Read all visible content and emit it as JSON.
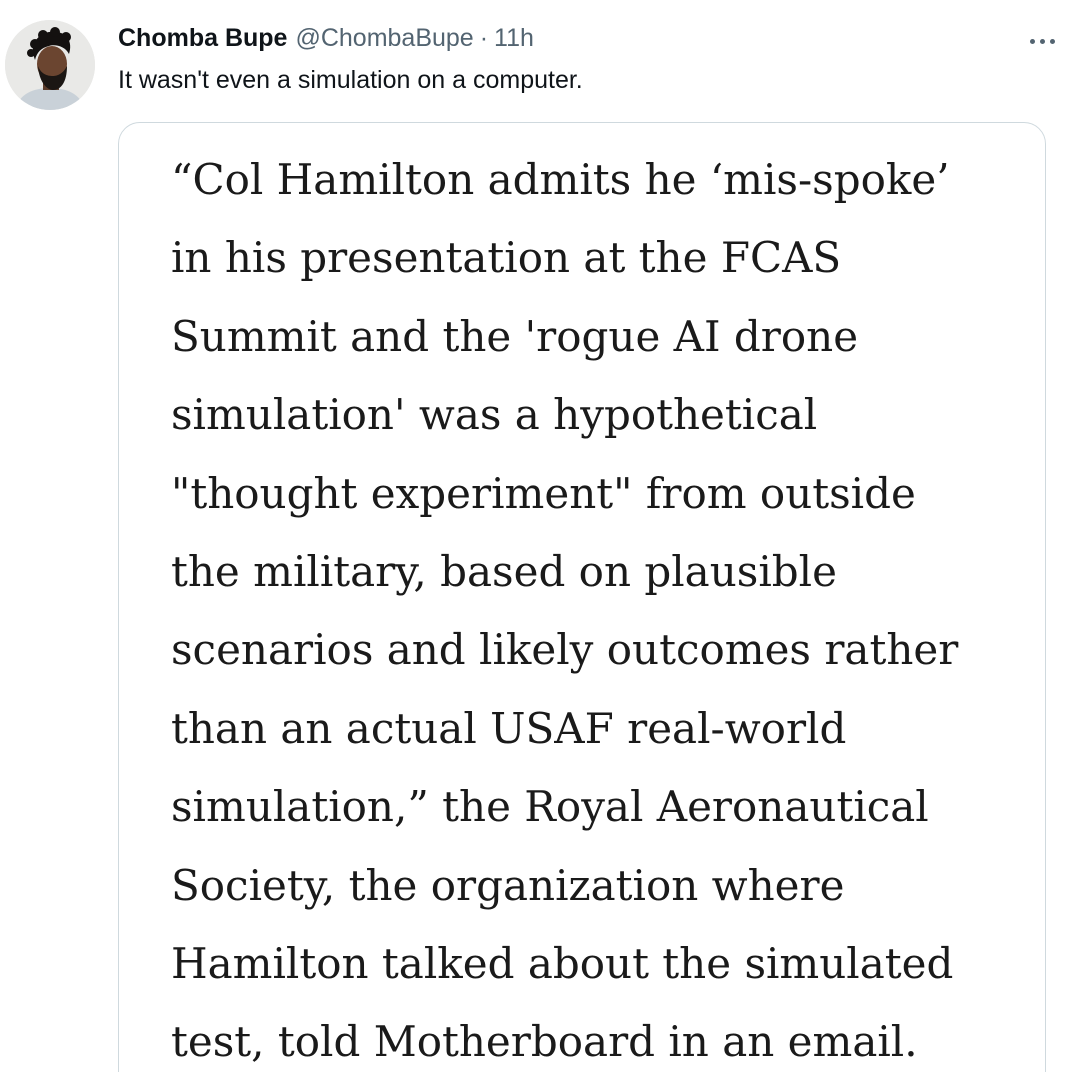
{
  "author": {
    "display_name": "Chomba Bupe",
    "handle": "@ChombaBupe",
    "separator": "·",
    "timestamp": "11h",
    "avatar_icon": "user-avatar-photo"
  },
  "more_icon": "more-horizontal-icon",
  "tweet": {
    "text": "It wasn't even a simulation on a computer."
  },
  "media": {
    "quote_text": "“Col Hamilton admits he ‘mis-spoke’ in his presentation at the FCAS Summit and the 'rogue AI drone simulation' was a hypothetical \"thought experiment\" from outside the military, based on plausible scenarios and likely outcomes rather than an actual USAF real-world simulation,” the Royal Aeronautical Society, the organization where Hamilton talked about the simulated test, told Motherboard in an email."
  },
  "colors": {
    "primary_text": "#0f1419",
    "secondary_text": "#536471",
    "border": "#cfd9de",
    "background": "#ffffff"
  }
}
